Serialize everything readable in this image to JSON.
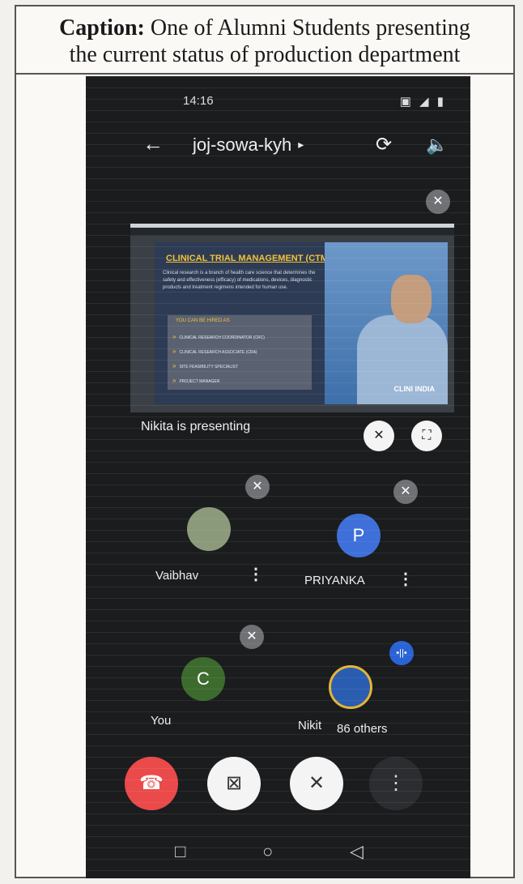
{
  "caption": {
    "label": "Caption:",
    "text": "One of Alumni Students presenting",
    "line2": "the current status of production department"
  },
  "status_bar": {
    "time": "14:16",
    "indicators": "▣ ◢ ▮"
  },
  "meeting": {
    "code": "joj-sowa-kyh",
    "caret": "▸"
  },
  "icons": {
    "back": "←",
    "camera-flip": "⟳",
    "speaker": "🔈",
    "mic-off": "✕",
    "unpin": "✕",
    "fullscreen": "⛶",
    "end-call": "☎",
    "video-off": "⊠",
    "more": "⋮",
    "nav-back": "◁",
    "nav-home": "○",
    "nav-recents": "□",
    "activity": "•||•"
  },
  "shared_slide": {
    "title": "CLINICAL TRIAL MANAGEMENT (CTM)",
    "body": "Clinical research is a branch of health care science that determines the safety and effectiveness (efficacy) of medications, devices, diagnostic products and treatment regimens intended for human use.",
    "list_heading": "YOU CAN BE HIRED AS",
    "list": [
      "CLINICAL RESEARCH COORDINATOR (CRC)",
      "CLINICAL RESEARCH ASSOCIATE (CRA)",
      "SITE FEASIBILITY SPECIALIST",
      "PROJECT MANAGER"
    ],
    "brand": "CLINI INDIA"
  },
  "presenting_label": "Nikita is presenting",
  "participants": [
    {
      "name": "Vaibhav",
      "initial": "",
      "color": "#8a9a7a"
    },
    {
      "name": "PRIYANKA",
      "initial": "P",
      "color": "#3f6fd9"
    },
    {
      "name": "You",
      "initial": "C",
      "color": "#3d6b2e"
    },
    {
      "name": "Nikit",
      "initial": "",
      "color": "#2a5db0",
      "extra": "86 others"
    }
  ],
  "colors": {
    "end_call": "#ea4a4a",
    "background": "#1b1c1e"
  }
}
